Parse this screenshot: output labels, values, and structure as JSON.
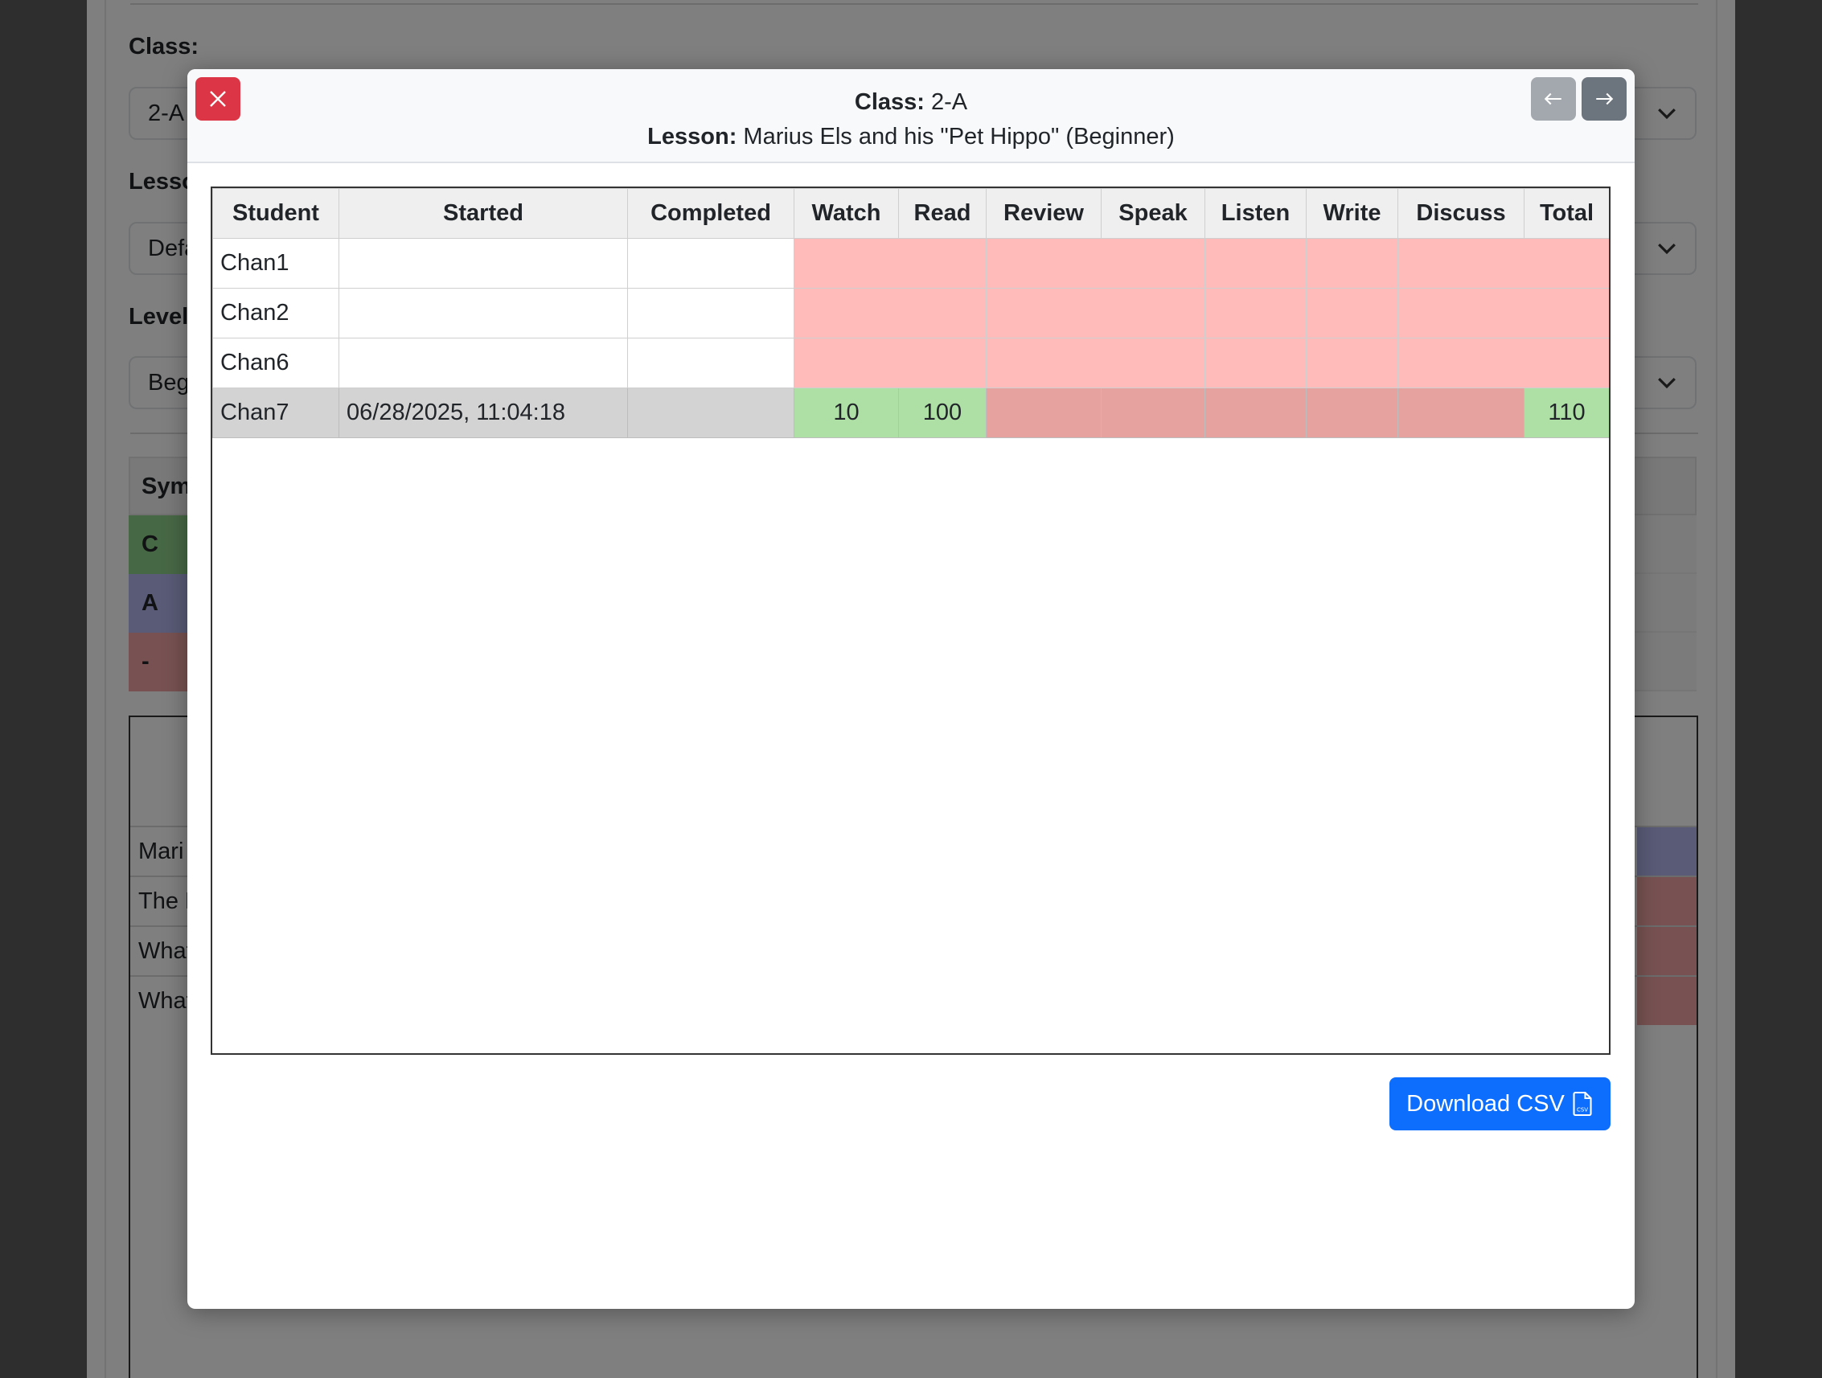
{
  "background": {
    "class_label": "Class:",
    "class_value": "2-A",
    "lesson_label": "Lesso",
    "lesson_value": "Defa",
    "level_label": "Level",
    "level_value": "Beg",
    "legend_header": "Sym",
    "legend_rows": [
      "C",
      "A",
      "-"
    ],
    "list_rows": [
      "Mari",
      "The H",
      "What",
      "What"
    ]
  },
  "modal": {
    "class_label": "Class:",
    "class_value": "2-A",
    "lesson_label": "Lesson:",
    "lesson_value": "Marius Els and his \"Pet Hippo\" (Beginner)",
    "close_icon": "close-icon",
    "prev_icon": "arrow-left-icon",
    "next_icon": "arrow-right-icon",
    "table": {
      "columns": [
        "Student",
        "Started",
        "Completed",
        "Watch",
        "Read",
        "Review",
        "Speak",
        "Listen",
        "Write",
        "Discuss",
        "Total"
      ],
      "rows": [
        {
          "student": "Chan1",
          "started": "",
          "completed": "",
          "watch": "",
          "read": "",
          "review": "",
          "speak": "",
          "listen": "",
          "write": "",
          "discuss": "",
          "total": ""
        },
        {
          "student": "Chan2",
          "started": "",
          "completed": "",
          "watch": "",
          "read": "",
          "review": "",
          "speak": "",
          "listen": "",
          "write": "",
          "discuss": "",
          "total": ""
        },
        {
          "student": "Chan6",
          "started": "",
          "completed": "",
          "watch": "",
          "read": "",
          "review": "",
          "speak": "",
          "listen": "",
          "write": "",
          "discuss": "",
          "total": ""
        },
        {
          "student": "Chan7",
          "started": "06/28/2025, 11:04:18",
          "completed": "",
          "watch": "10",
          "read": "100",
          "review": "",
          "speak": "",
          "listen": "",
          "write": "",
          "discuss": "",
          "total": "110"
        }
      ]
    },
    "download_label": "Download CSV",
    "download_icon": "csv-file-icon"
  },
  "colors": {
    "danger": "#dc3545",
    "primary": "#0d6efd",
    "secondary": "#6c757d",
    "not_started": "#ffbaba",
    "completed": "#aee0a5",
    "in_progress_missing": "#e5a29e",
    "active_row": "#d3d3d3"
  }
}
